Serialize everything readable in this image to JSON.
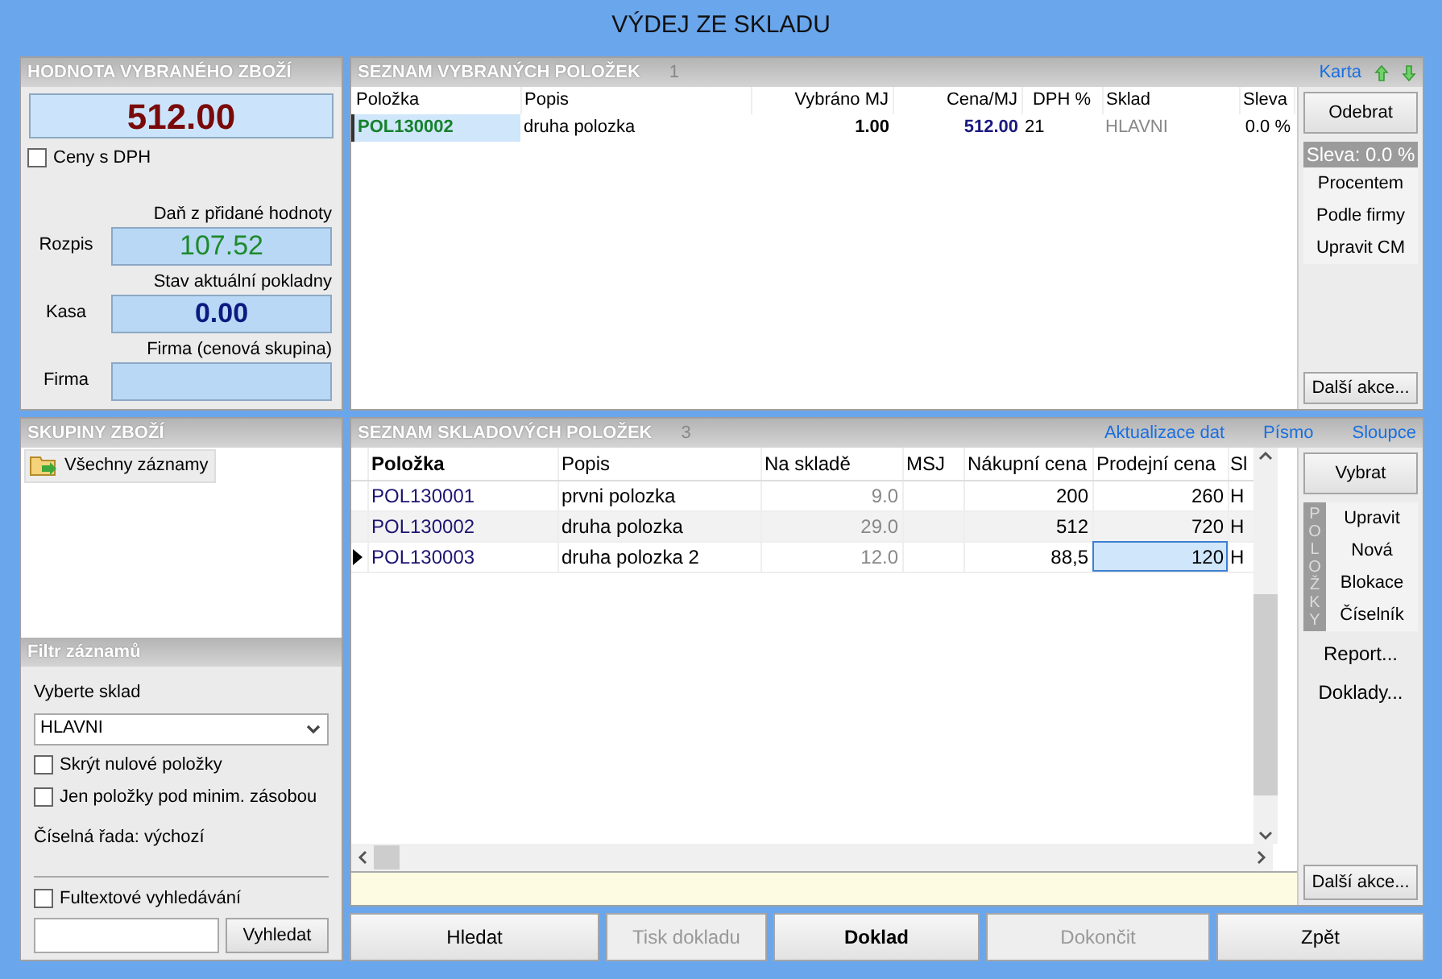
{
  "window": {
    "title": "VÝDEJ ZE SKLADU"
  },
  "value_panel": {
    "title": "HODNOTA VYBRANÉHO ZBOŽÍ",
    "total": "512.00",
    "prices_with_vat": {
      "label": "Ceny s DPH",
      "checked": false
    },
    "fields": [
      {
        "caption": "Daň z přidané hodnoty",
        "label": "Rozpis",
        "value": "107.52",
        "kind": "vat"
      },
      {
        "caption": "Stav aktuální pokladny",
        "label": "Kasa",
        "value": "0.00",
        "kind": "cash"
      },
      {
        "caption": "Firma (cenová skupina)",
        "label": "Firma",
        "kind": "firm"
      }
    ]
  },
  "selected_items": {
    "title": "SEZNAM VYBRANÝCH POLOŽEK",
    "count": "1",
    "link": "Karta",
    "columns": [
      "Položka",
      "Popis",
      "Vybráno MJ",
      "Cena/MJ",
      "DPH %",
      "Sklad",
      "Sleva"
    ],
    "rows": [
      {
        "item": "POL130002",
        "description": "druha polozka",
        "quantity": "1.00",
        "unit_price": "512.00",
        "vat": "21",
        "warehouse": "HLAVNI",
        "discount": "0.0 %",
        "selected": true
      }
    ],
    "remove_button": "Odebrat",
    "discount_title": "Sleva: 0.0 %",
    "discount_actions": [
      "Procentem",
      "Podle firmy",
      "Upravit CM"
    ],
    "more_button": "Další akce..."
  },
  "groups": {
    "title": "SKUPINY ZBOŽÍ",
    "items": [
      {
        "label": "Všechny záznamy",
        "selected": true
      }
    ]
  },
  "filter": {
    "title": "Filtr záznamů",
    "warehouse_label": "Vyberte sklad",
    "warehouse": "HLAVNI",
    "options": [
      {
        "label": "Skrýt nulové položky",
        "checked": false
      },
      {
        "label": "Jen položky pod minim. zásobou",
        "checked": false
      }
    ],
    "number_series": "Číselná řada: výchozí",
    "fulltext": {
      "label": "Fultextové vyhledávání",
      "checked": false
    },
    "search_button": "Vyhledat"
  },
  "stock_items": {
    "title": "SEZNAM SKLADOVÝCH POLOŽEK",
    "count": "3",
    "links": [
      "Aktualizace dat",
      "Písmo",
      "Sloupce"
    ],
    "columns": [
      "Položka",
      "Popis",
      "Na skladě",
      "MSJ",
      "Nákupní cena",
      "Prodejní cena",
      "Sl"
    ],
    "rows": [
      {
        "item": "POL130001",
        "description": "prvni polozka",
        "in_stock": "9.0",
        "purchase_price": "200",
        "sale_price": "260",
        "column_7": "H",
        "selected": false
      },
      {
        "item": "POL130002",
        "description": "druha polozka",
        "in_stock": "29.0",
        "purchase_price": "512",
        "sale_price": "720",
        "column_7": "H",
        "selected": false
      },
      {
        "item": "POL130003",
        "description": "druha polozka 2",
        "in_stock": "12.0",
        "purchase_price": "88,5",
        "sale_price": "120",
        "column_7": "H",
        "selected": true
      }
    ],
    "select_button": "Vybrat",
    "group_label": "POLOŽKY",
    "actions": [
      "Upravit",
      "Nová",
      "Blokace",
      "Číselník"
    ],
    "links_below": [
      "Report...",
      "Doklady..."
    ],
    "more_button": "Další akce..."
  },
  "buttons": [
    {
      "label": "Hledat",
      "disabled": false,
      "default": false
    },
    {
      "label": "Tisk dokladu",
      "disabled": true,
      "default": false
    },
    {
      "label": "Doklad",
      "disabled": false,
      "default": true
    },
    {
      "label": "Dokončit",
      "disabled": true,
      "default": false
    },
    {
      "label": "Zpět",
      "disabled": false,
      "default": false
    }
  ]
}
